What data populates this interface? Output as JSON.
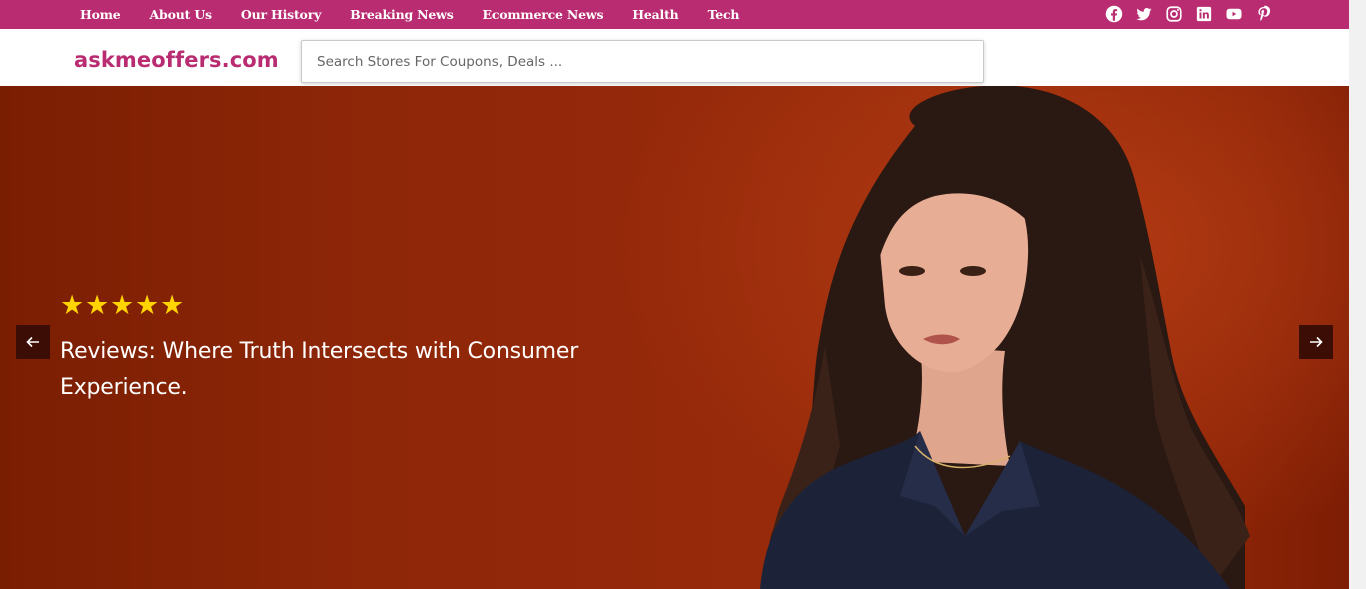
{
  "topbar": {
    "nav": [
      {
        "label": "Home"
      },
      {
        "label": "About Us"
      },
      {
        "label": "Our History"
      },
      {
        "label": "Breaking News"
      },
      {
        "label": "Ecommerce News"
      },
      {
        "label": "Health"
      },
      {
        "label": "Tech"
      }
    ],
    "social_icons": [
      "facebook-icon",
      "twitter-icon",
      "instagram-icon",
      "linkedin-icon",
      "youtube-icon",
      "pinterest-icon"
    ]
  },
  "header": {
    "logo": "askmeoffers.com",
    "search_placeholder": "Search Stores For Coupons, Deals ..."
  },
  "hero": {
    "rating": "★★★★★",
    "headline": "Reviews: Where Truth Intersects with Consumer Experience.",
    "prev_icon": "arrow-left-icon",
    "next_icon": "arrow-right-icon"
  },
  "colors": {
    "brand": "#b92c71",
    "hero_bg": "#922a0a",
    "star": "#ffd400",
    "arrow_bg": "#3b0d05"
  }
}
